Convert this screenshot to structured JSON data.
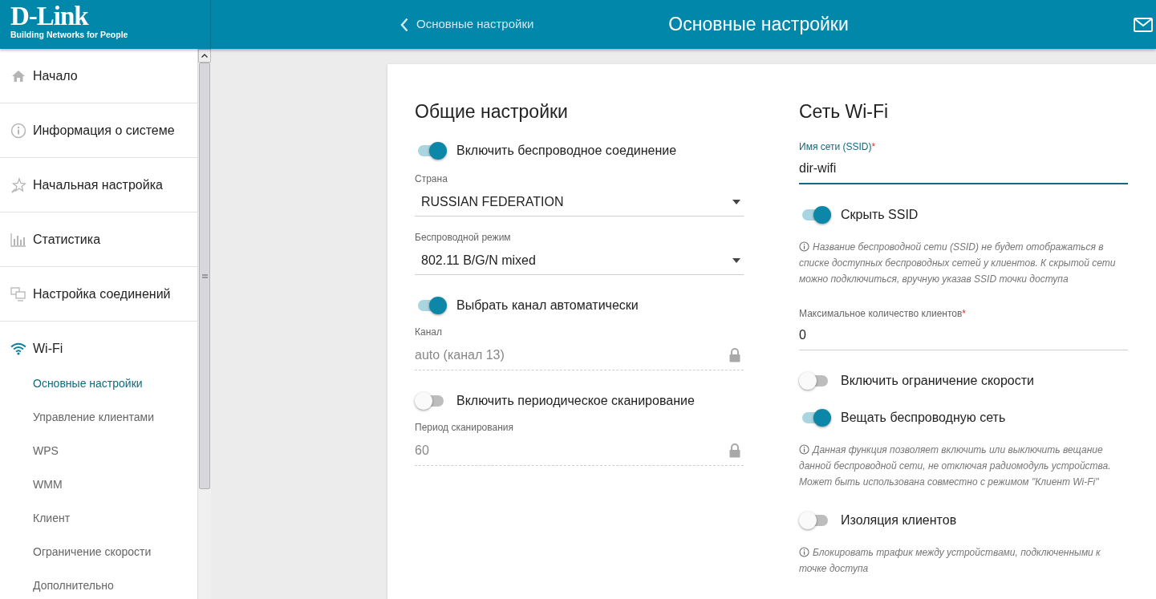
{
  "logo": {
    "name": "D-Link",
    "tagline": "Building Networks for People"
  },
  "header": {
    "back_label": "Основные настройки",
    "title": "Основные настройки"
  },
  "sidebar": {
    "items": [
      {
        "label": "Начало",
        "selected": false
      },
      {
        "label": "Информация о системе",
        "selected": false
      },
      {
        "label": "Начальная настройка",
        "selected": false
      },
      {
        "label": "Статистика",
        "selected": false
      },
      {
        "label": "Настройка соединений",
        "selected": false
      },
      {
        "label": "Wi-Fi",
        "selected": false,
        "children": [
          {
            "label": "Основные настройки",
            "selected": true
          },
          {
            "label": "Управление клиентами",
            "selected": false
          },
          {
            "label": "WPS",
            "selected": false
          },
          {
            "label": "WMM",
            "selected": false
          },
          {
            "label": "Клиент",
            "selected": false
          },
          {
            "label": "Ограничение скорости",
            "selected": false
          },
          {
            "label": "Дополнительно",
            "selected": false
          }
        ]
      }
    ]
  },
  "sections": [
    {
      "title": "Общие настройки",
      "items": [
        {
          "kind": "toggle",
          "label": "Включить беспроводное соединение",
          "on": true
        },
        {
          "kind": "select",
          "label": "Страна",
          "value": "RUSSIAN FEDERATION"
        },
        {
          "kind": "select",
          "label": "Беспроводной режим",
          "value": "802.11 B/G/N mixed"
        },
        {
          "kind": "toggle",
          "label": "Выбрать канал автоматически",
          "on": true
        },
        {
          "kind": "locked",
          "label": "Канал",
          "value": "auto (канал 13)"
        },
        {
          "kind": "toggle",
          "label": "Включить периодическое сканирование",
          "on": false
        },
        {
          "kind": "locked",
          "label": "Период сканирования",
          "value": "60"
        }
      ]
    },
    {
      "title": "Сеть Wi-Fi",
      "items": [
        {
          "kind": "text",
          "label": "Имя сети (SSID)",
          "required_mark": "*",
          "focused": true,
          "value": "dir-wifi"
        },
        {
          "kind": "toggle",
          "label": "Скрыть SSID",
          "on": true
        },
        {
          "kind": "hint",
          "text": "Название беспроводной сети (SSID) не будет отображаться в списке доступных беспроводных сетей у клиентов. К скрытой сети можно подключиться, вручную указав SSID точки доступа"
        },
        {
          "kind": "text",
          "label": "Максимальное количество клиентов",
          "required_mark": "*",
          "focused": false,
          "value": "0"
        },
        {
          "kind": "toggle",
          "label": "Включить ограничение скорости",
          "on": false
        },
        {
          "kind": "toggle",
          "label": "Вещать беспроводную сеть",
          "on": true
        },
        {
          "kind": "hint",
          "text": "Данная функция позволяет включить или выключить вещание данной беспроводной сети, не отключая радиомодуль устройства. Может быть использована совместно с режимом \"Клиент Wi-Fi\""
        },
        {
          "kind": "toggle",
          "label": "Изоляция клиентов",
          "on": false
        },
        {
          "kind": "hint",
          "text": "Блокировать трафик между устройствами, подключенными к точке доступа"
        }
      ]
    }
  ]
}
